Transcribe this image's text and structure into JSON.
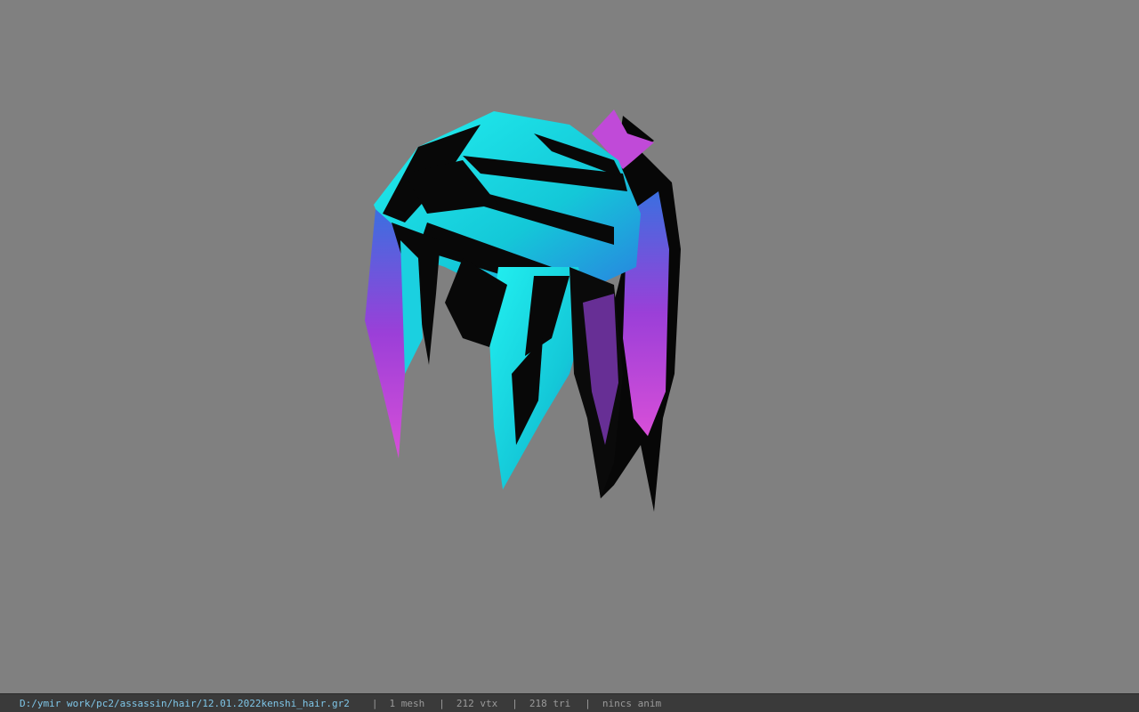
{
  "viewer": {
    "model_name": "kenshi_hair",
    "background_color": "#808080",
    "hair_colors": {
      "primary": "#19e0e0",
      "secondary": "#b24bd6",
      "shadow": "#0a0a0a"
    }
  },
  "status": {
    "file_path": "D:/ymir work/pc2/assassin/hair/12.01.2022kenshi_hair.gr2",
    "separator": "|",
    "meshes": "1 mesh",
    "vertices": "212 vtx",
    "triangles": "218 tri",
    "animation": "nincs anim"
  }
}
